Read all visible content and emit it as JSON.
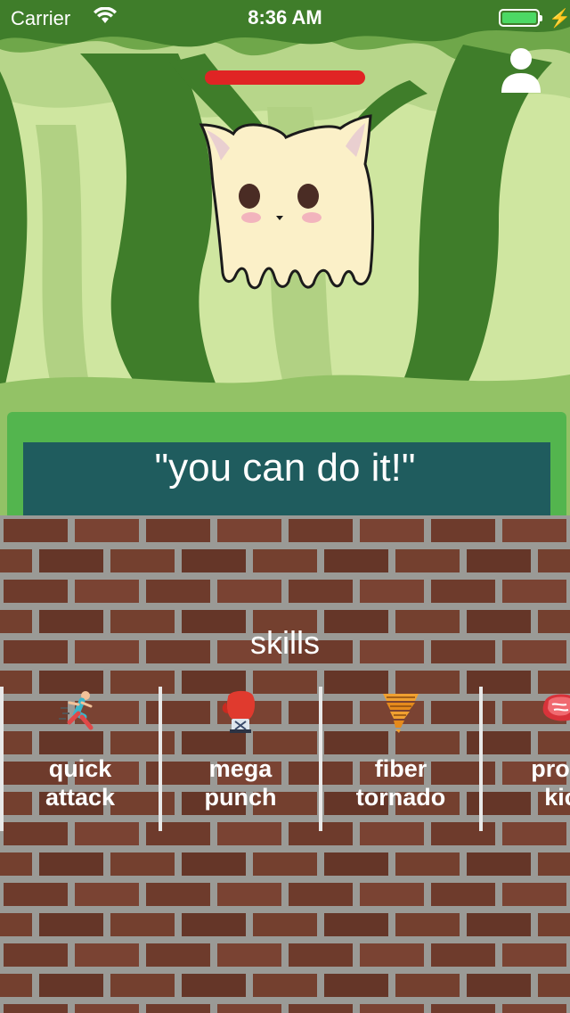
{
  "status_bar": {
    "carrier": "Carrier",
    "time": "8:36 AM"
  },
  "enemy": {
    "hp_fraction": 1.0
  },
  "dialog": {
    "quote": "\"you can do it!\""
  },
  "skills_section": {
    "title": "skills",
    "items": [
      {
        "line1": "quick",
        "line2": "attack",
        "icon": "running-person-icon"
      },
      {
        "line1": "mega",
        "line2": "punch",
        "icon": "boxing-glove-icon"
      },
      {
        "line1": "fiber",
        "line2": "tornado",
        "icon": "tornado-icon"
      },
      {
        "line1": "prote",
        "line2": "kic",
        "icon": "meat-steak-icon"
      }
    ]
  },
  "colors": {
    "hp": "#e02424",
    "dialog_bg": "#1f5c5e",
    "hedge": "#53b54e",
    "battery": "#4cd964"
  }
}
